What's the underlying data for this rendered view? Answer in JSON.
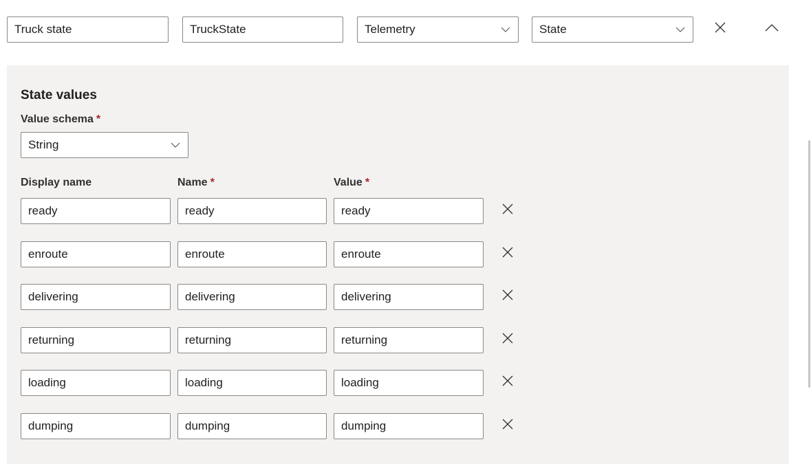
{
  "header": {
    "display_name": "Truck state",
    "name": "TruckState",
    "capability_type": "Telemetry",
    "semantic_type": "State"
  },
  "icons": {
    "delete": "close-icon",
    "collapse": "chevron-up-icon",
    "dropdown": "chevron-down-icon"
  },
  "state_values": {
    "title": "State values",
    "value_schema_label": "Value schema",
    "required_marker": "*",
    "value_schema": "String",
    "columns": {
      "display_name": "Display name",
      "name": "Name",
      "value": "Value"
    },
    "rows": [
      {
        "display_name": "ready",
        "name": "ready",
        "value": "ready"
      },
      {
        "display_name": "enroute",
        "name": "enroute",
        "value": "enroute"
      },
      {
        "display_name": "delivering",
        "name": "delivering",
        "value": "delivering"
      },
      {
        "display_name": "returning",
        "name": "returning",
        "value": "returning"
      },
      {
        "display_name": "loading",
        "name": "loading",
        "value": "loading"
      },
      {
        "display_name": "dumping",
        "name": "dumping",
        "value": "dumping"
      }
    ]
  },
  "colors": {
    "panel_bg": "#f3f2f1",
    "border": "#8a8886",
    "required": "#a4262c"
  }
}
